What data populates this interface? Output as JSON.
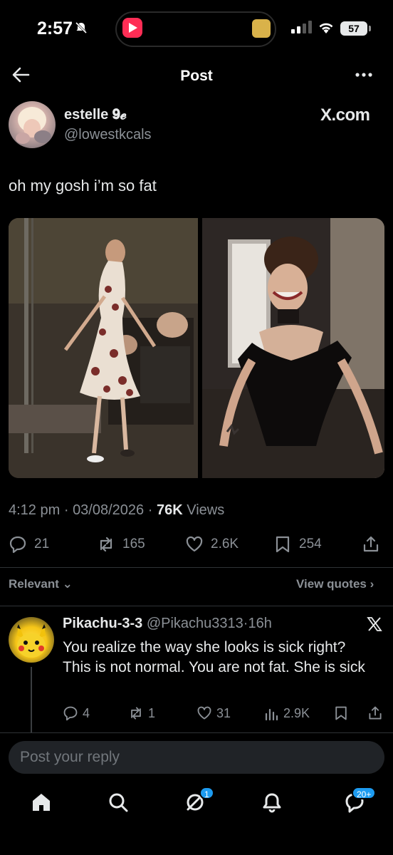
{
  "status_bar": {
    "time": "2:57",
    "battery": "57"
  },
  "header": {
    "title": "Post"
  },
  "post": {
    "author_name": "estelle 𝟗𝓮",
    "author_handle": "@lowestkcals",
    "source": "X.com",
    "text": "oh my gosh i’m so fat",
    "time": "4:12 pm",
    "date": "03/08/2026",
    "views_count": "76K",
    "views_label": "Views",
    "replies": "21",
    "reposts": "165",
    "likes": "2.6K",
    "bookmarks": "254"
  },
  "sort": {
    "relevant_label": "Relevant",
    "view_quotes_label": "View quotes"
  },
  "reply": {
    "name": "Pikachu-3-3",
    "handle": "@Pikachu3313",
    "age": "16h",
    "text": "You realize the way she looks is sick right? This is not normal. You are not fat. She is sick",
    "replies": "4",
    "reposts": "1",
    "likes": "31",
    "views": "2.9K"
  },
  "composer": {
    "placeholder": "Post your reply"
  },
  "tabbar": {
    "grok_badge": "1",
    "messages_badge": "20+"
  },
  "colors": {
    "background": "#000000",
    "text": "#e7e9ea",
    "muted": "#8b9096",
    "accent": "#1d9bf0"
  }
}
